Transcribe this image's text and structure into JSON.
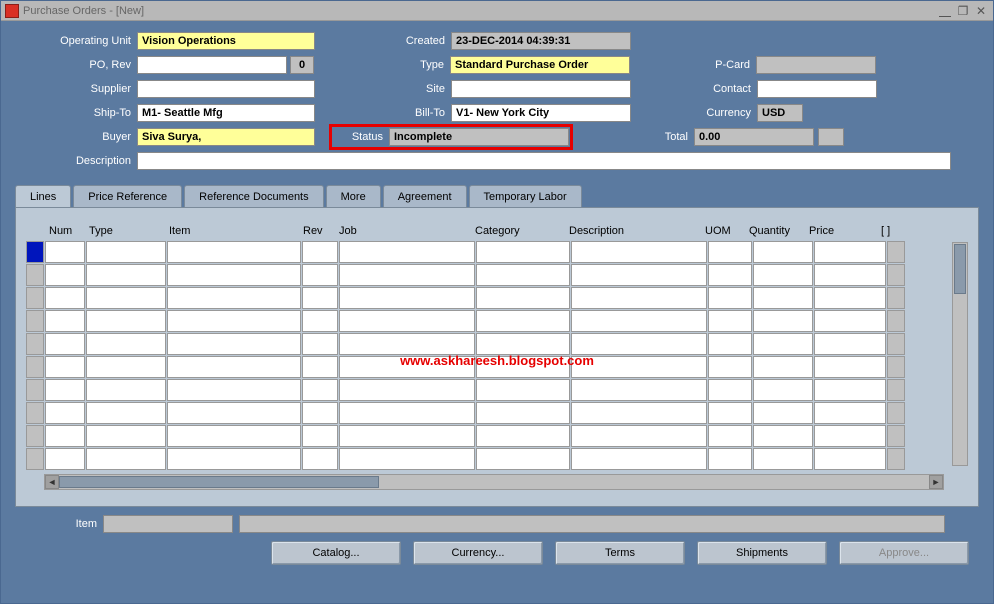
{
  "window": {
    "title": "Purchase Orders - [New]"
  },
  "header": {
    "labels": {
      "operating_unit": "Operating Unit",
      "po_rev": "PO, Rev",
      "supplier": "Supplier",
      "ship_to": "Ship-To",
      "buyer": "Buyer",
      "description": "Description",
      "created": "Created",
      "type": "Type",
      "site": "Site",
      "bill_to": "Bill-To",
      "status": "Status",
      "pcard": "P-Card",
      "contact": "Contact",
      "currency": "Currency",
      "total": "Total"
    },
    "values": {
      "operating_unit": "Vision Operations",
      "po": "",
      "rev": "0",
      "supplier": "",
      "ship_to": "M1- Seattle Mfg",
      "buyer": "Siva Surya,",
      "description": "",
      "created": "23-DEC-2014 04:39:31",
      "type": "Standard Purchase Order",
      "site": "",
      "bill_to": "V1- New York City",
      "status": "Incomplete",
      "pcard": "",
      "contact": "",
      "currency": "USD",
      "total": "0.00"
    }
  },
  "tabs": [
    "Lines",
    "Price Reference",
    "Reference Documents",
    "More",
    "Agreement",
    "Temporary Labor"
  ],
  "active_tab": 0,
  "grid": {
    "columns": [
      "Num",
      "Type",
      "Item",
      "Rev",
      "Job",
      "Category",
      "Description",
      "UOM",
      "Quantity",
      "Price",
      "[ ]"
    ],
    "row_count": 10
  },
  "bottom": {
    "item_label": "Item",
    "item_code": "",
    "item_desc": ""
  },
  "buttons": [
    "Catalog...",
    "Currency...",
    "Terms",
    "Shipments",
    "Approve..."
  ],
  "watermark": "www.askhareesh.blogspot.com"
}
